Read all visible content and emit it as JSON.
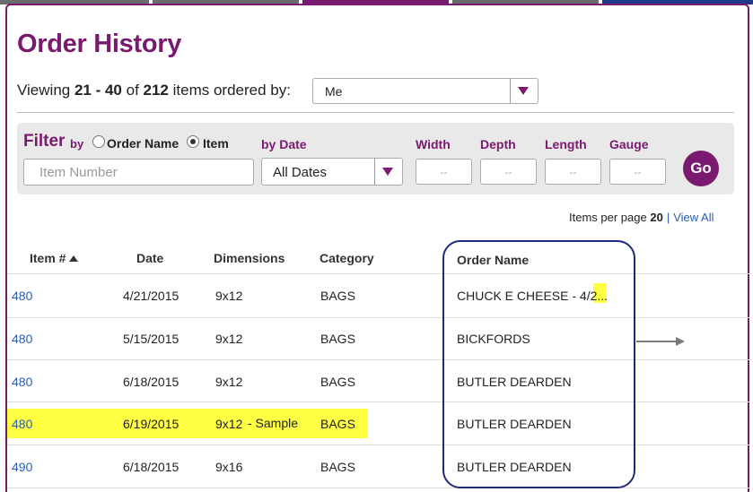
{
  "header": {
    "title": "Order History",
    "viewing_prefix": "Viewing ",
    "range": "21 - 40",
    "of_word": " of ",
    "total": "212",
    "suffix": " items ordered by:",
    "ordered_by_value": "Me"
  },
  "filter": {
    "filter_word": "Filter",
    "by_word": "by",
    "radio_order_name": "Order Name",
    "radio_item": "Item",
    "selected_radio": "Item",
    "item_number_placeholder": "Item Number",
    "by_date_label": "by Date",
    "date_value": "All Dates",
    "width_label": "Width",
    "depth_label": "Depth",
    "length_label": "Length",
    "gauge_label": "Gauge",
    "dim_placeholder": "--",
    "go_label": "Go"
  },
  "pager": {
    "items_per_page_label": "Items per page",
    "items_per_page": "20",
    "separator": "|",
    "view_all": "View All"
  },
  "table": {
    "headers": {
      "item": "Item #",
      "date": "Date",
      "dimensions": "Dimensions",
      "category": "Category",
      "order_name": "Order Name"
    },
    "rows": [
      {
        "item": "480",
        "date": "4/21/2015",
        "dimensions": "9x12",
        "note": "",
        "category": "BAGS",
        "order_name": "CHUCK E CHEESE - 4/2",
        "truncation": "..."
      },
      {
        "item": "480",
        "date": "5/15/2015",
        "dimensions": "9x12",
        "note": "",
        "category": "BAGS",
        "order_name": "BICKFORDS",
        "truncation": ""
      },
      {
        "item": "480",
        "date": "6/18/2015",
        "dimensions": "9x12",
        "note": "",
        "category": "BAGS",
        "order_name": "BUTLER DEARDEN",
        "truncation": ""
      },
      {
        "item": "480",
        "date": "6/19/2015",
        "dimensions": "9x12",
        "note": "- Sample",
        "category": "BAGS",
        "order_name": "BUTLER DEARDEN",
        "truncation": ""
      },
      {
        "item": "490",
        "date": "6/18/2015",
        "dimensions": "9x16",
        "note": "",
        "category": "BAGS",
        "order_name": "BUTLER DEARDEN",
        "truncation": ""
      }
    ]
  },
  "colors": {
    "brand": "#7a1a6e",
    "link": "#2a5db0",
    "highlight": "#ffff44",
    "callout": "#1f2a7a"
  }
}
